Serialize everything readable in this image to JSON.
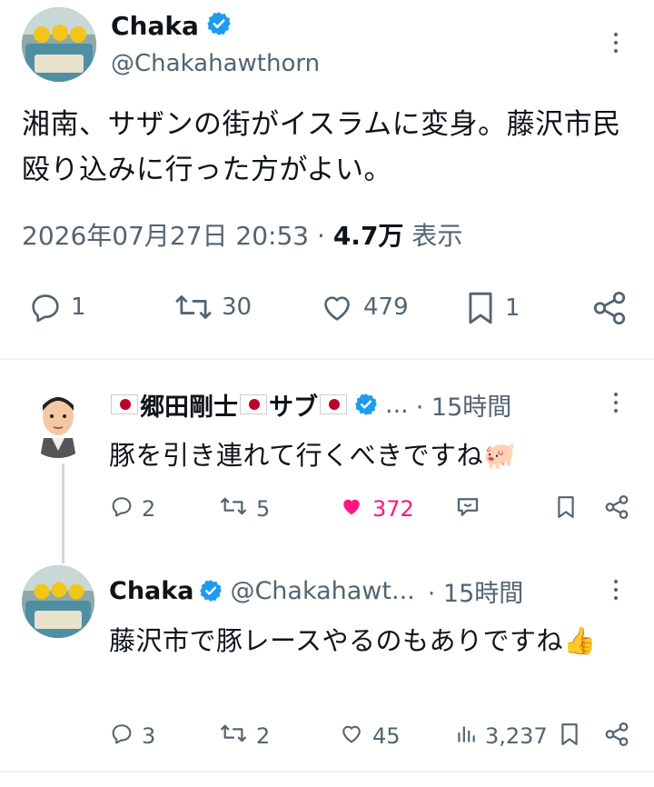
{
  "main": {
    "name": "Chaka",
    "handle": "@Chakahawthorn",
    "text": "湘南、サザンの街がイスラムに変身。藤沢市民殴り込みに行った方がよい。",
    "timestamp": "2026年07月27日 20:53",
    "separator": "·",
    "views": "4.7万",
    "views_label": "表示",
    "replies": "1",
    "retweets": "30",
    "likes": "479",
    "bookmarks": "1"
  },
  "replies": [
    {
      "name_part1": "郷田剛士",
      "name_part2": "サブ",
      "ellipsis": "...",
      "time": "· 15時間",
      "text": "豚を引き連れて行くべきですね🐖",
      "replies": "2",
      "retweets": "5",
      "likes": "372",
      "liked": true
    },
    {
      "name": "Chaka",
      "handle": "@Chakahawt...",
      "time": "· 15時間",
      "text": "藤沢市で豚レースやるのもありですね👍",
      "replies": "3",
      "retweets": "2",
      "likes": "45",
      "views": "3,237"
    }
  ],
  "colors": {
    "verified": "#1d9bf0",
    "like_active": "#f91880",
    "secondary_text": "#536471"
  }
}
